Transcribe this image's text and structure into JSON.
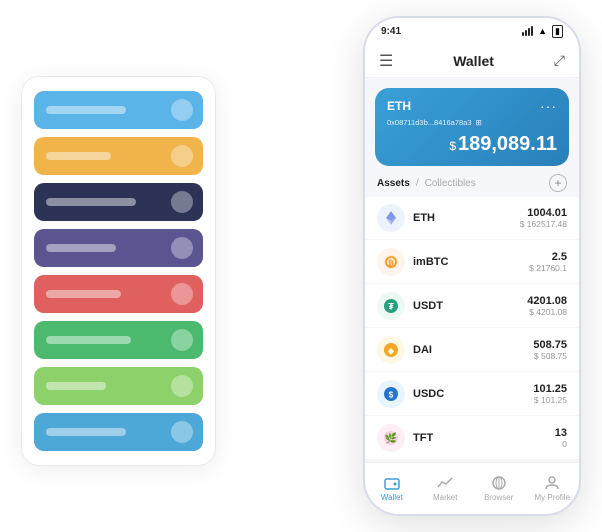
{
  "left_stack": {
    "cards": [
      {
        "color": "card-blue",
        "text_width": "80px"
      },
      {
        "color": "card-orange",
        "text_width": "65px"
      },
      {
        "color": "card-dark",
        "text_width": "90px"
      },
      {
        "color": "card-purple",
        "text_width": "70px"
      },
      {
        "color": "card-red",
        "text_width": "75px"
      },
      {
        "color": "card-green",
        "text_width": "85px"
      },
      {
        "color": "card-ltgreen",
        "text_width": "60px"
      },
      {
        "color": "card-sky",
        "text_width": "80px"
      }
    ]
  },
  "status_bar": {
    "time": "9:41",
    "signal": true,
    "wifi": true,
    "battery": true
  },
  "nav": {
    "menu_label": "☰",
    "title": "Wallet",
    "expand_label": "⤢"
  },
  "eth_card": {
    "name": "ETH",
    "address": "0x08711d3b...8416a78a3",
    "address_icon": "⊞",
    "more": "···",
    "balance_symbol": "$",
    "balance": "189,089.11"
  },
  "assets_section": {
    "tab_active": "Assets",
    "tab_divider": "/",
    "tab_inactive": "Collectibles",
    "add_icon": "+"
  },
  "assets": [
    {
      "name": "ETH",
      "icon": "♦",
      "icon_class": "icon-eth",
      "amount": "1004.01",
      "usd": "$ 162517.48"
    },
    {
      "name": "imBTC",
      "icon": "⊙",
      "icon_class": "icon-imbtc",
      "amount": "2.5",
      "usd": "$ 21760.1"
    },
    {
      "name": "USDT",
      "icon": "⊛",
      "icon_class": "icon-usdt",
      "amount": "4201.08",
      "usd": "$ 4201.08"
    },
    {
      "name": "DAI",
      "icon": "◉",
      "icon_class": "icon-dai",
      "amount": "508.75",
      "usd": "$ 508.75"
    },
    {
      "name": "USDC",
      "icon": "◎",
      "icon_class": "icon-usdc",
      "amount": "101.25",
      "usd": "$ 101.25"
    },
    {
      "name": "TFT",
      "icon": "❋",
      "icon_class": "icon-tft",
      "amount": "13",
      "usd": "0"
    }
  ],
  "bottom_nav": [
    {
      "label": "Wallet",
      "icon": "⊙",
      "active": true
    },
    {
      "label": "Market",
      "icon": "📈",
      "active": false
    },
    {
      "label": "Browser",
      "icon": "⊕",
      "active": false
    },
    {
      "label": "My Profile",
      "icon": "👤",
      "active": false
    }
  ]
}
